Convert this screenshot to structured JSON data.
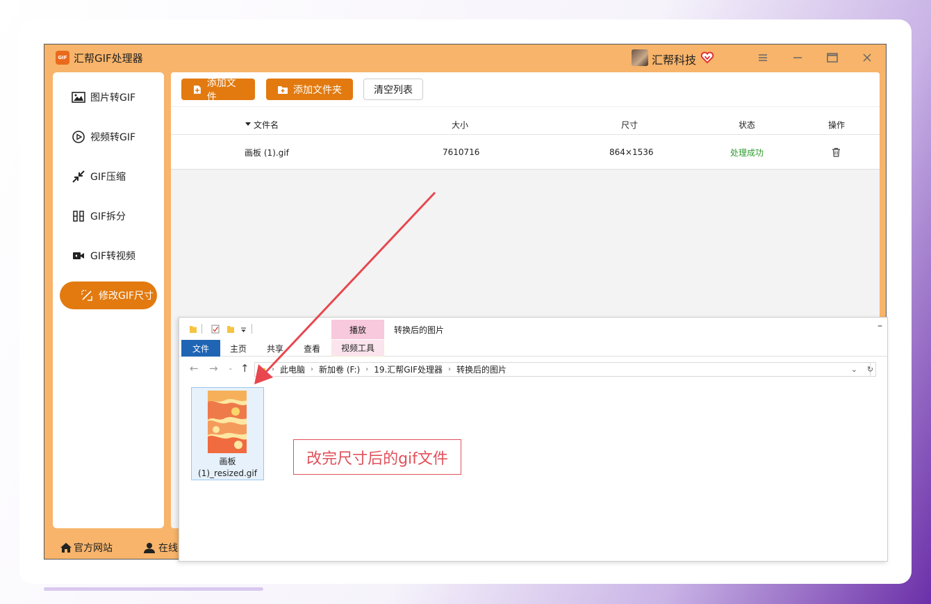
{
  "app": {
    "title": "汇帮GIF处理器",
    "logo_text": "GIF",
    "brand": "汇帮科技",
    "accent": "#e27a10",
    "frame_color": "#f7b46a"
  },
  "sidebar": {
    "items": [
      {
        "label": "图片转GIF",
        "icon": "image-icon"
      },
      {
        "label": "视频转GIF",
        "icon": "play-circle-icon"
      },
      {
        "label": "GIF压缩",
        "icon": "compress-arrows-icon"
      },
      {
        "label": "GIF拆分",
        "icon": "split-icon"
      },
      {
        "label": "GIF转视频",
        "icon": "video-camera-icon"
      },
      {
        "label": "修改GIF尺寸",
        "icon": "resize-icon",
        "active": true
      }
    ],
    "footer": {
      "website": "官方网站",
      "support": "在线"
    }
  },
  "toolbar": {
    "add_file": "添加文件",
    "add_folder": "添加文件夹",
    "clear_list": "清空列表"
  },
  "table": {
    "headers": {
      "filename": "文件名",
      "size": "大小",
      "dimensions": "尺寸",
      "status": "状态",
      "actions": "操作"
    },
    "rows": [
      {
        "filename": "画板 (1).gif",
        "size": "7610716",
        "dimensions": "864×1536",
        "status": "处理成功"
      }
    ],
    "status_color": "#2e9a2e"
  },
  "explorer": {
    "context_tab": "播放",
    "title": "转换后的图片",
    "tabs": {
      "file": "文件",
      "home": "主页",
      "share": "共享",
      "view": "查看",
      "video_tools": "视频工具"
    },
    "breadcrumb": [
      "此电脑",
      "新加卷 (F:)",
      "19.汇帮GIF处理器",
      "转换后的图片"
    ],
    "file": {
      "name_line1": "画板",
      "name_line2": "(1)_resized.gif"
    }
  },
  "annotation": {
    "text": "改完尺寸后的gif文件",
    "color": "#e0505a"
  }
}
